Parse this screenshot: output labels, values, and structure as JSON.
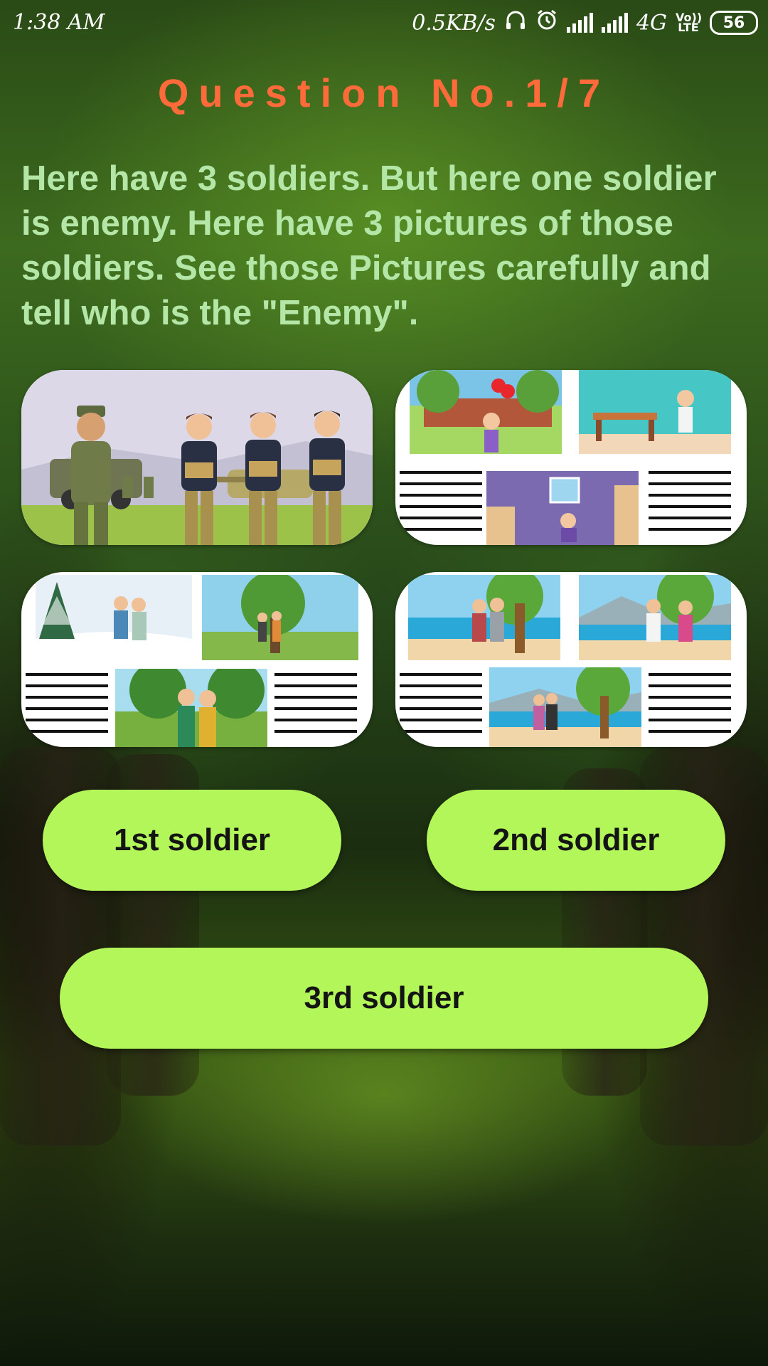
{
  "status_bar": {
    "time": "1:38 AM",
    "net_speed": "0.5KB/s",
    "network": "4G",
    "volte": "Vo)) LTE",
    "battery": "56",
    "icons": [
      "headphones-icon",
      "alarm-icon",
      "signal-icon",
      "signal-icon",
      "battery-icon"
    ]
  },
  "question": {
    "title": "Question No.1/7",
    "text": "Here have 3 soldiers. But here one soldier is enemy. Here have 3 pictures of those soldiers. See those Pictures carefully and tell who is the \"Enemy\"."
  },
  "cards": [
    {
      "name": "soldiers-group-picture"
    },
    {
      "name": "first-soldier-memories-picture"
    },
    {
      "name": "second-soldier-memories-picture"
    },
    {
      "name": "third-soldier-memories-picture"
    }
  ],
  "answers": {
    "first": "1st soldier",
    "second": "2nd soldier",
    "third": "3rd soldier"
  },
  "colors": {
    "title": "#ff6a3a",
    "question_text": "#b4e6a8",
    "button": "#b3f65a"
  }
}
